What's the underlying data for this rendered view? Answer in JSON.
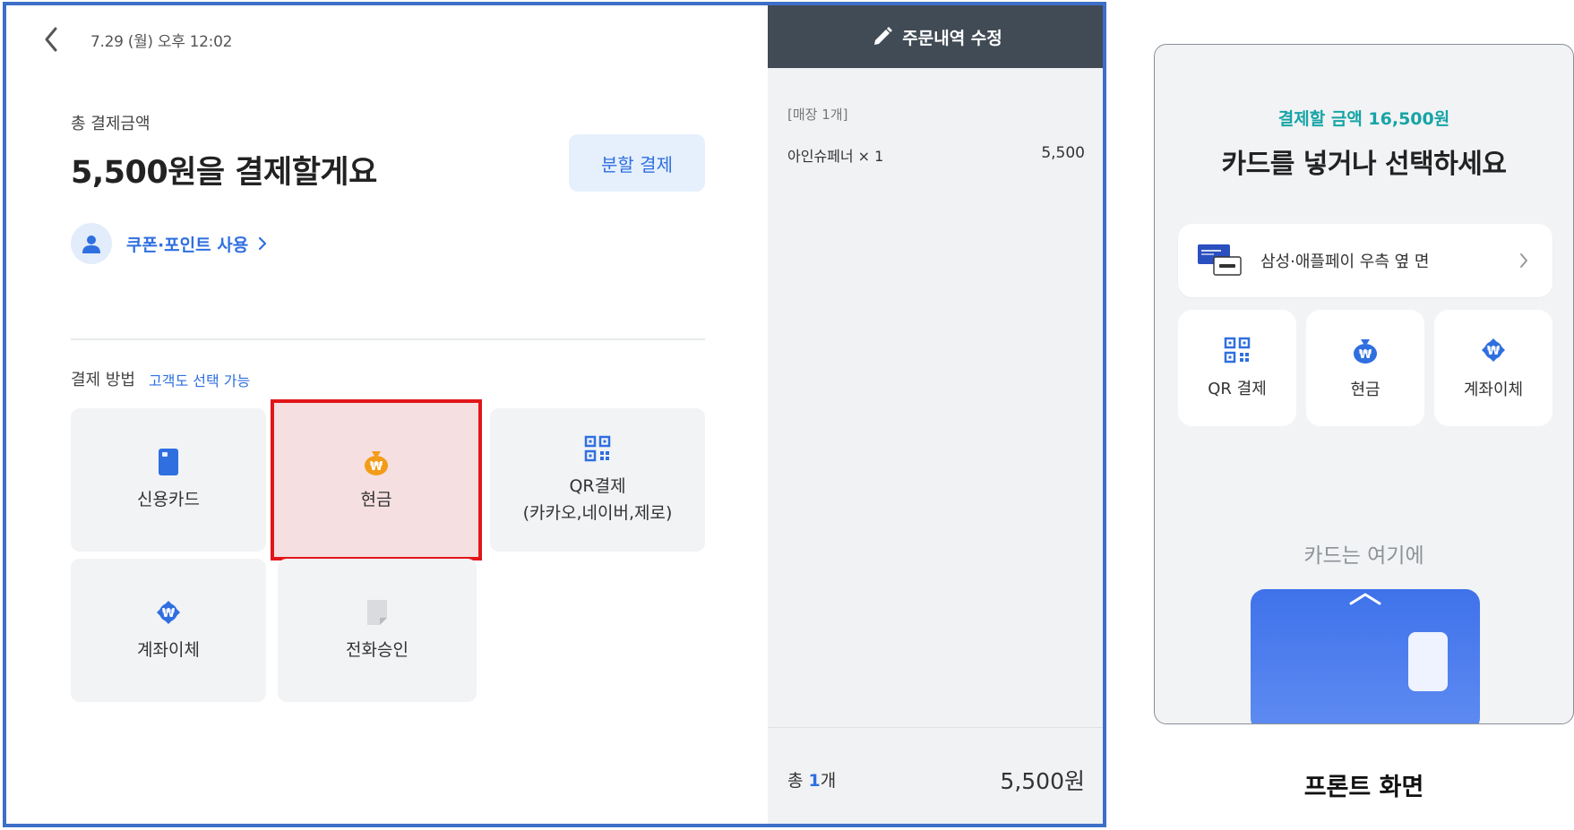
{
  "pos": {
    "datetime": "7.29 (월) 오후 12:02",
    "total_label": "총 결제금액",
    "pay_title": "5,500원을 결제할게요",
    "split_button": "분할 결제",
    "coupon_label": "쿠폰·포인트 사용",
    "method_label": "결제 방법",
    "method_hint": "고객도 선택 가능",
    "methods": {
      "card": "신용카드",
      "cash": "현금",
      "qr_line1": "QR결제",
      "qr_line2": "(카카오,네이버,제로)",
      "transfer": "계좌이체",
      "phone": "전화승인"
    },
    "selected_method": "현금",
    "order": {
      "header": "주문내역 수정",
      "store_label": "[매장 1개]",
      "item_name": "아인슈페너 × 1",
      "item_price": "5,500",
      "total_prefix": "총",
      "total_count": "1",
      "total_suffix": "개",
      "total_price": "5,500원"
    }
  },
  "front": {
    "amount_text": "결제할 금액 16,500원",
    "title": "카드를 넣거나 선택하세요",
    "samsung_label": "삼성·애플페이 우측 옆 면",
    "tiles": {
      "qr": "QR 결제",
      "cash": "현금",
      "transfer": "계좌이체"
    },
    "hint": "카드는 여기에"
  },
  "caption": "프론트 화면",
  "colors": {
    "frame_border": "#3e6fc8",
    "accent_blue": "#2f6fe0",
    "header_dark": "#414b55",
    "selected_highlight": "#e1161a",
    "cash_orange": "#f39c1a",
    "amount_teal": "#17a4a6"
  },
  "icons": {
    "back": "chevron-left-icon",
    "user": "user-icon",
    "card": "credit-card-icon",
    "cash": "money-bag-icon",
    "qr": "qr-code-icon",
    "transfer": "won-transfer-icon",
    "phone": "document-icon",
    "edit": "pencil-icon"
  }
}
